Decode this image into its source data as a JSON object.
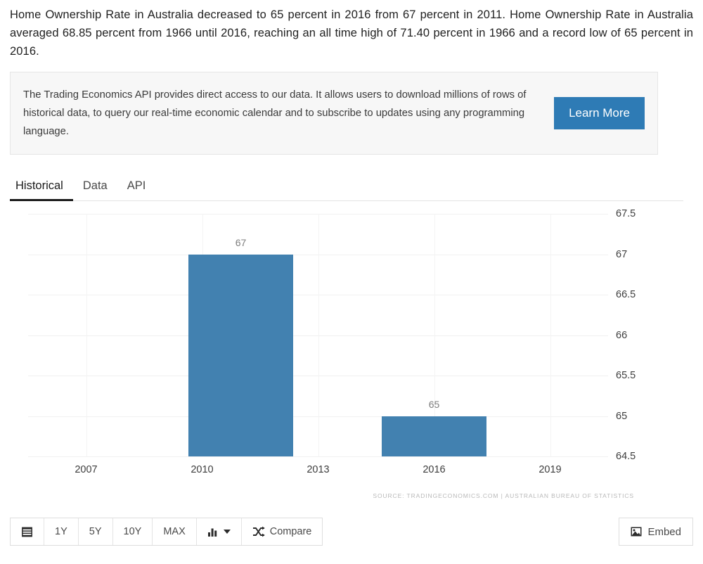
{
  "intro": {
    "text": "Home Ownership Rate in Australia decreased to 65 percent in 2016 from 67 percent in 2011. Home Ownership Rate in Australia averaged 68.85 percent from 1966 until 2016, reaching an all time high of 71.40 percent in 1966 and a record low of 65 percent in 2016."
  },
  "promo": {
    "text": "The Trading Economics API provides direct access to our data. It allows users to download millions of rows of historical data, to query our real-time economic calendar and to subscribe to updates using any programming language.",
    "button_label": "Learn More",
    "button_color": "#2e7bb5"
  },
  "tabs": [
    {
      "label": "Historical",
      "active": true
    },
    {
      "label": "Data",
      "active": false
    },
    {
      "label": "API",
      "active": false
    }
  ],
  "toolbar": {
    "calendar_icon": "calendar-icon",
    "ranges": [
      "1Y",
      "5Y",
      "10Y",
      "MAX"
    ],
    "chart_type_icon": "bar-chart-icon",
    "chart_type_caret": "chevron-down-icon",
    "compare_icon": "shuffle-icon",
    "compare_label": "Compare",
    "embed_icon": "image-icon",
    "embed_label": "Embed"
  },
  "chart_data": {
    "type": "bar",
    "title": "",
    "xlabel": "",
    "ylabel": "",
    "categories": [
      "2011",
      "2016"
    ],
    "values": [
      67,
      65
    ],
    "data_labels": [
      "67",
      "65"
    ],
    "bar_color": "#4281b0",
    "ylim": [
      64.5,
      67.5
    ],
    "yticks": [
      "67.5",
      "67",
      "66.5",
      "66",
      "65.5",
      "65",
      "64.5"
    ],
    "ytick_values": [
      67.5,
      67,
      66.5,
      66,
      65.5,
      65,
      64.5
    ],
    "xticks": [
      "2007",
      "2010",
      "2013",
      "2016",
      "2019"
    ],
    "xtick_values": [
      2007,
      2010,
      2013,
      2016,
      2019
    ],
    "xlim": [
      2005.5,
      2020.5
    ],
    "grid": true,
    "legend": "none",
    "source": "SOURCE: TRADINGECONOMICS.COM | AUSTRALIAN BUREAU OF STATISTICS"
  }
}
